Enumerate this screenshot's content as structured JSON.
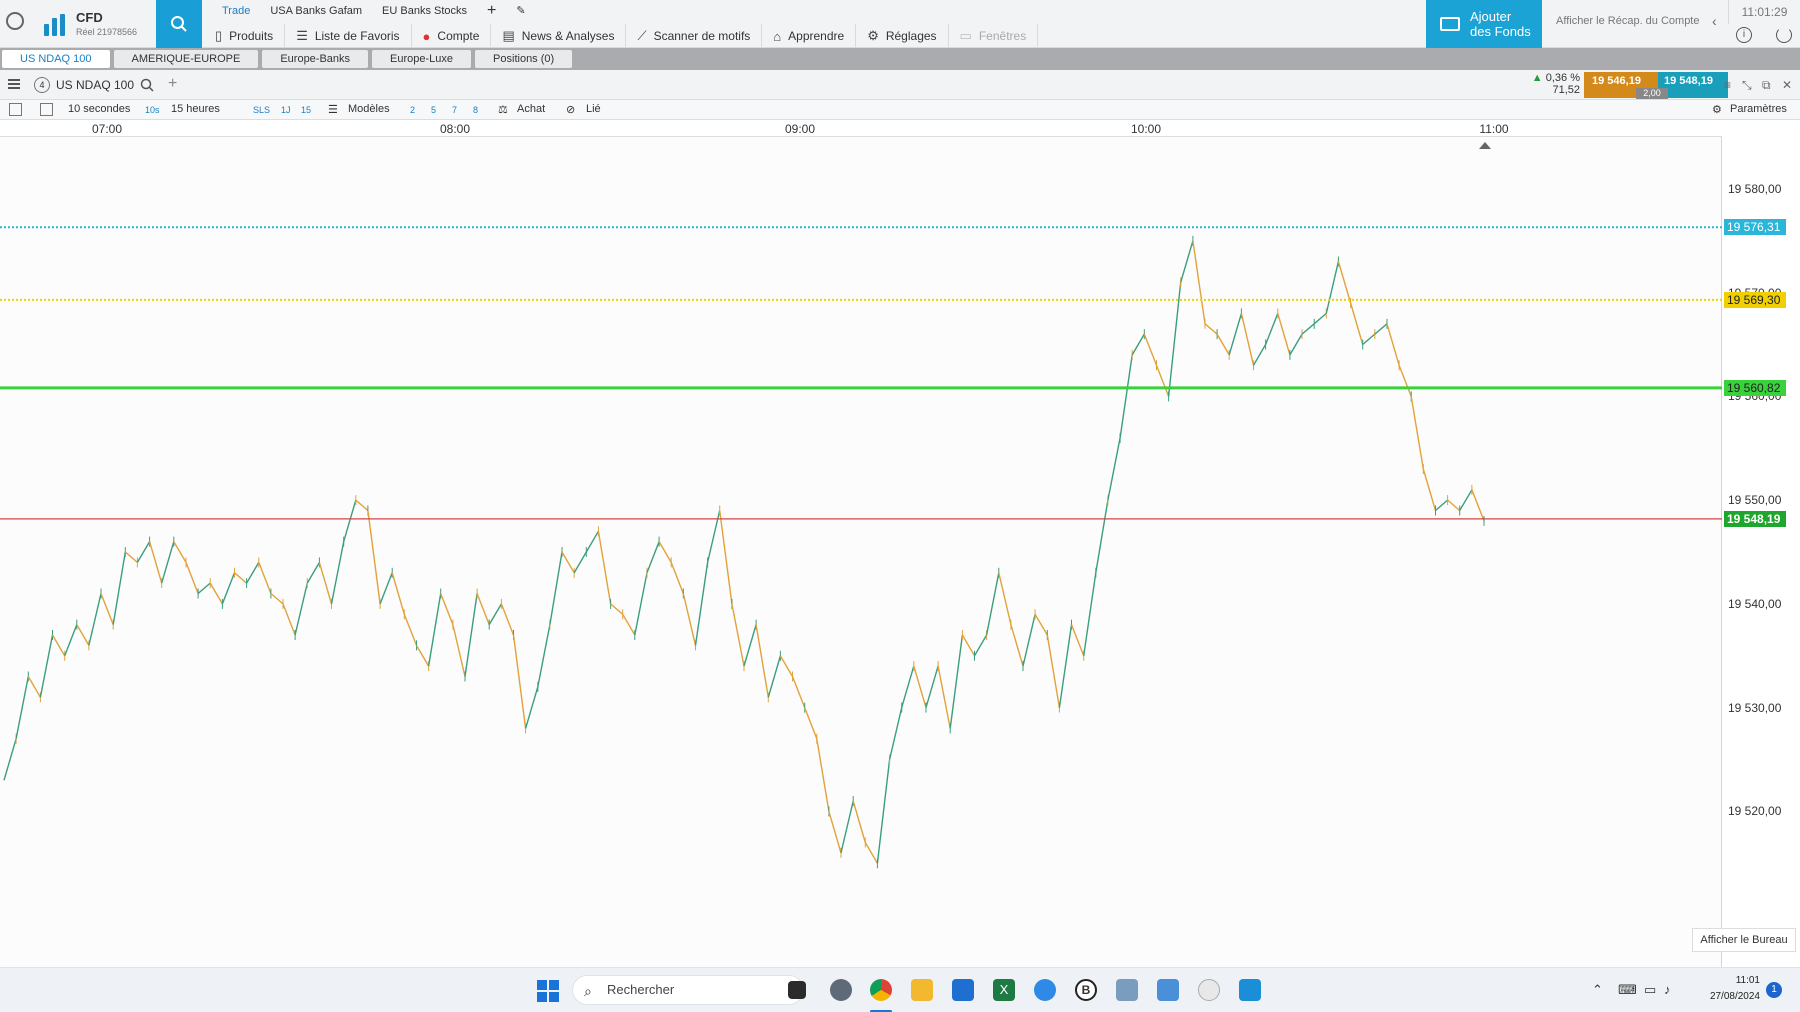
{
  "topbar": {
    "brand": "CFD",
    "account": "Réel 21978566",
    "tabs": [
      "Trade",
      "USA Banks Gafam",
      "EU Banks Stocks"
    ],
    "menu": [
      {
        "label": "Produits",
        "icon": "phone-icon"
      },
      {
        "label": "Liste de Favoris",
        "icon": "list-icon"
      },
      {
        "label": "Compte",
        "icon": "account-icon"
      },
      {
        "label": "News & Analyses",
        "icon": "news-icon"
      },
      {
        "label": "Scanner de motifs",
        "icon": "scanner-icon"
      },
      {
        "label": "Apprendre",
        "icon": "learn-icon"
      },
      {
        "label": "Réglages",
        "icon": "gear-icon"
      },
      {
        "label": "Fenêtres",
        "icon": "window-icon"
      }
    ],
    "add_funds_line1": "Ajouter",
    "add_funds_line2": "des Fonds",
    "recap": "Afficher le Récap. du Compte",
    "clock": "11:01:29"
  },
  "watchlist_tabs": [
    "US NDAQ 100",
    "AMERIQUE-EUROPE",
    "Europe-Banks",
    "Europe-Luxe",
    "Positions (0)"
  ],
  "chart_header": {
    "badge": "4",
    "instrument": "US NDAQ 100",
    "change_pct": "0,36 %",
    "change_abs": "71,52",
    "sell_price": "19 546,19",
    "buy_price": "19 548,19",
    "spread": "2,00"
  },
  "toolbar": {
    "interval": "10 secondes",
    "interval_short": "10s",
    "range": "15 heures",
    "presets": [
      "SLS",
      "1J",
      "15"
    ],
    "models": "Modèles",
    "levels": [
      "2",
      "5",
      "7",
      "8"
    ],
    "buy": "Achat",
    "linked": "Lié",
    "params": "Paramètres"
  },
  "chart_data": {
    "type": "line",
    "instrument": "US NDAQ 100",
    "interval": "10s",
    "x_ticks": [
      "07:00",
      "08:00",
      "09:00",
      "10:00",
      "11:00"
    ],
    "y_ticks": [
      "19 520,00",
      "19 530,00",
      "19 540,00",
      "19 550,00",
      "19 560,00",
      "19 570,00",
      "19 580,00"
    ],
    "ylim": [
      19505,
      19585
    ],
    "series": [
      {
        "values": [
          19523,
          19527,
          19533,
          19531,
          19537,
          19535,
          19538,
          19536,
          19541,
          19538,
          19545,
          19544,
          19546,
          19542,
          19546,
          19544,
          19541,
          19542,
          19540,
          19543,
          19542,
          19544,
          19541,
          19540,
          19537,
          19542,
          19544,
          19540,
          19546,
          19550,
          19549,
          19540,
          19543,
          19539,
          19536,
          19534,
          19541,
          19538,
          19533,
          19541,
          19538,
          19540,
          19537,
          19528,
          19532,
          19538,
          19545,
          19543,
          19545,
          19547,
          19540,
          19539,
          19537,
          19543,
          19546,
          19544,
          19541,
          19536,
          19544,
          19549,
          19540,
          19534,
          19538,
          19531,
          19535,
          19533,
          19530,
          19527,
          19520,
          19516,
          19521,
          19517,
          19515,
          19525,
          19530,
          19534,
          19530,
          19534,
          19528,
          19537,
          19535,
          19537,
          19543,
          19538,
          19534,
          19539,
          19537,
          19530,
          19538,
          19535,
          19543,
          19550,
          19556,
          19564,
          19566,
          19563,
          19560,
          19571,
          19575,
          19567,
          19566,
          19564,
          19568,
          19563,
          19565,
          19568,
          19564,
          19566,
          19567,
          19568,
          19573,
          19569,
          19565,
          19566,
          19567,
          19563,
          19560,
          19553,
          19549,
          19550,
          19549,
          19551,
          19548
        ]
      }
    ],
    "levels": [
      {
        "label": "19 576,31",
        "value": 19576.31,
        "color": "#2bb6d9",
        "style": "dotted"
      },
      {
        "label": "19 569,30",
        "value": 19569.3,
        "color": "#f0d000",
        "style": "dotted"
      },
      {
        "label": "19 560,82",
        "value": 19560.82,
        "color": "#39d13c",
        "style": "solid"
      },
      {
        "label": "19 548,19",
        "value": 19548.19,
        "color": "#d24545",
        "style": "solid",
        "tag_color": "#1fa62e"
      }
    ],
    "colors": {
      "up": "#3a9e7d",
      "down": "#e2a23a"
    }
  },
  "overlay": {
    "show_desktop": "Afficher le Bureau"
  },
  "taskbar": {
    "search_placeholder": "Rechercher",
    "time": "11:01",
    "date": "27/08/2024",
    "notifications": "1"
  }
}
